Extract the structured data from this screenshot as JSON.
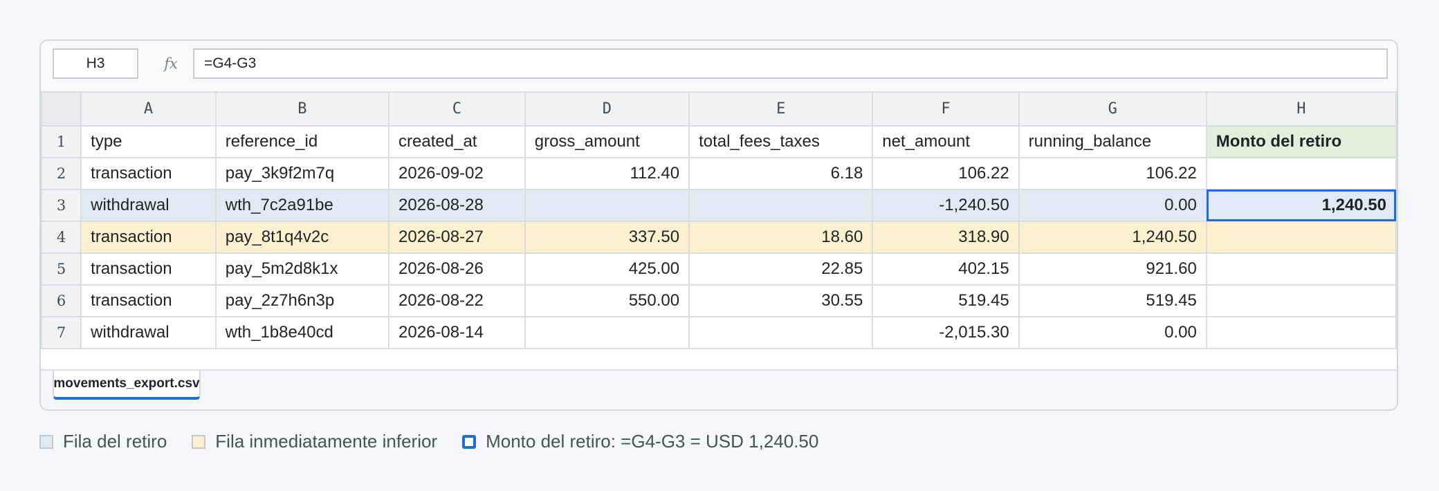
{
  "formula_bar": {
    "cell_ref": "H3",
    "fx_label": "fx",
    "formula": "=G4-G3"
  },
  "columns": [
    "A",
    "B",
    "C",
    "D",
    "E",
    "F",
    "G",
    "H"
  ],
  "rows": [
    {
      "num": "1",
      "cells": [
        "type",
        "reference_id",
        "created_at",
        "gross_amount",
        "total_fees_taxes",
        "net_amount",
        "running_balance",
        "Monto del retiro"
      ]
    },
    {
      "num": "2",
      "cells": [
        "transaction",
        "pay_3k9f2m7q",
        "2026-09-02",
        "112.40",
        "6.18",
        "106.22",
        "106.22",
        ""
      ]
    },
    {
      "num": "3",
      "cells": [
        "withdrawal",
        "wth_7c2a91be",
        "2026-08-28",
        "",
        "",
        "-1,240.50",
        "0.00",
        "1,240.50"
      ]
    },
    {
      "num": "4",
      "cells": [
        "transaction",
        "pay_8t1q4v2c",
        "2026-08-27",
        "337.50",
        "18.60",
        "318.90",
        "1,240.50",
        ""
      ]
    },
    {
      "num": "5",
      "cells": [
        "transaction",
        "pay_5m2d8k1x",
        "2026-08-26",
        "425.00",
        "22.85",
        "402.15",
        "921.60",
        ""
      ]
    },
    {
      "num": "6",
      "cells": [
        "transaction",
        "pay_2z7h6n3p",
        "2026-08-22",
        "550.00",
        "30.55",
        "519.45",
        "519.45",
        ""
      ]
    },
    {
      "num": "7",
      "cells": [
        "withdrawal",
        "wth_1b8e40cd",
        "2026-08-14",
        "",
        "",
        "-2,015.30",
        "0.00",
        ""
      ]
    }
  ],
  "sheet_tab": {
    "label": "movements_export.csv"
  },
  "legend": {
    "withdrawal_row": "Fila del retiro",
    "row_below": "Fila inmediatamente inferior",
    "amount": "Monto del retiro: =G4-G3 = USD 1,240.50"
  },
  "colors": {
    "withdrawal_highlight": "#dfeaf5",
    "below_highlight": "#fdf0cf",
    "result_header": "#e2efdc",
    "selection": "#1a6fd6"
  }
}
